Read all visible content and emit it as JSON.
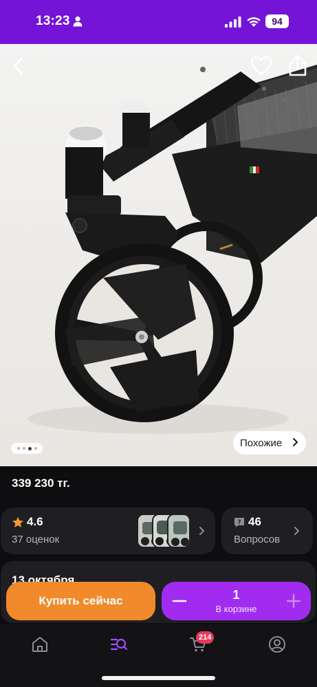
{
  "status_bar": {
    "time": "13:23",
    "battery": "94",
    "icons": [
      "person-icon",
      "signal-icon",
      "wifi-icon",
      "battery-icon"
    ]
  },
  "hero": {
    "icons": [
      "back-icon",
      "heart-icon",
      "share-icon"
    ],
    "gallery_pages": 4,
    "gallery_active_index": 2,
    "similar_label": "Похожие"
  },
  "product": {
    "price": "339 230 тг."
  },
  "rating_card": {
    "rating": "4.6",
    "reviews": "37 оценок"
  },
  "questions_card": {
    "count": "46",
    "label": "Вопросов"
  },
  "delivery": {
    "date": "13 октября"
  },
  "actions": {
    "buy_label": "Купить сейчас",
    "quantity": "1",
    "in_cart_label": "В корзине"
  },
  "bottom_nav": {
    "items": [
      "home-icon",
      "catalog-icon",
      "cart-icon",
      "profile-icon"
    ],
    "active": "catalog-icon",
    "cart_badge": "214"
  },
  "colors": {
    "header": "#7414d6",
    "buy_button": "#f08a2a",
    "cart_button": "#a12cf0",
    "active_nav": "#a64bff",
    "badge": "#e43b5c",
    "star": "#f39a2e"
  }
}
